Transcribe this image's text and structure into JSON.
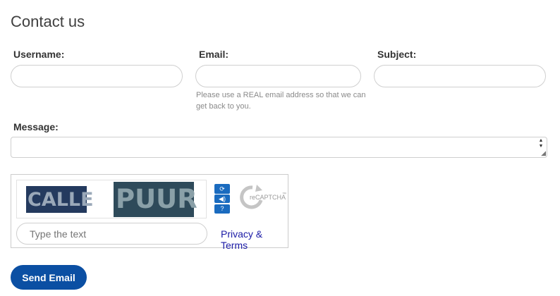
{
  "page": {
    "title": "Contact us"
  },
  "form": {
    "username": {
      "label": "Username:",
      "value": ""
    },
    "email": {
      "label": "Email:",
      "value": "",
      "help": "Please use a REAL email address so that we can get back to you."
    },
    "subject": {
      "label": "Subject:",
      "value": ""
    },
    "message": {
      "label": "Message:",
      "value": ""
    }
  },
  "captcha": {
    "word1": "CALLE",
    "word2": "PUUR",
    "input_placeholder": "Type the text",
    "privacy_link": "Privacy & Terms",
    "brand_prefix": "reCAPTCHA",
    "brand_tm": "™",
    "icons": [
      "refresh-icon",
      "audio-icon",
      "help-icon"
    ]
  },
  "actions": {
    "send_label": "Send Email"
  },
  "colors": {
    "primary": "#0b4fa3",
    "captcha_button": "#1a6bbf",
    "link": "#1a1aa6"
  }
}
